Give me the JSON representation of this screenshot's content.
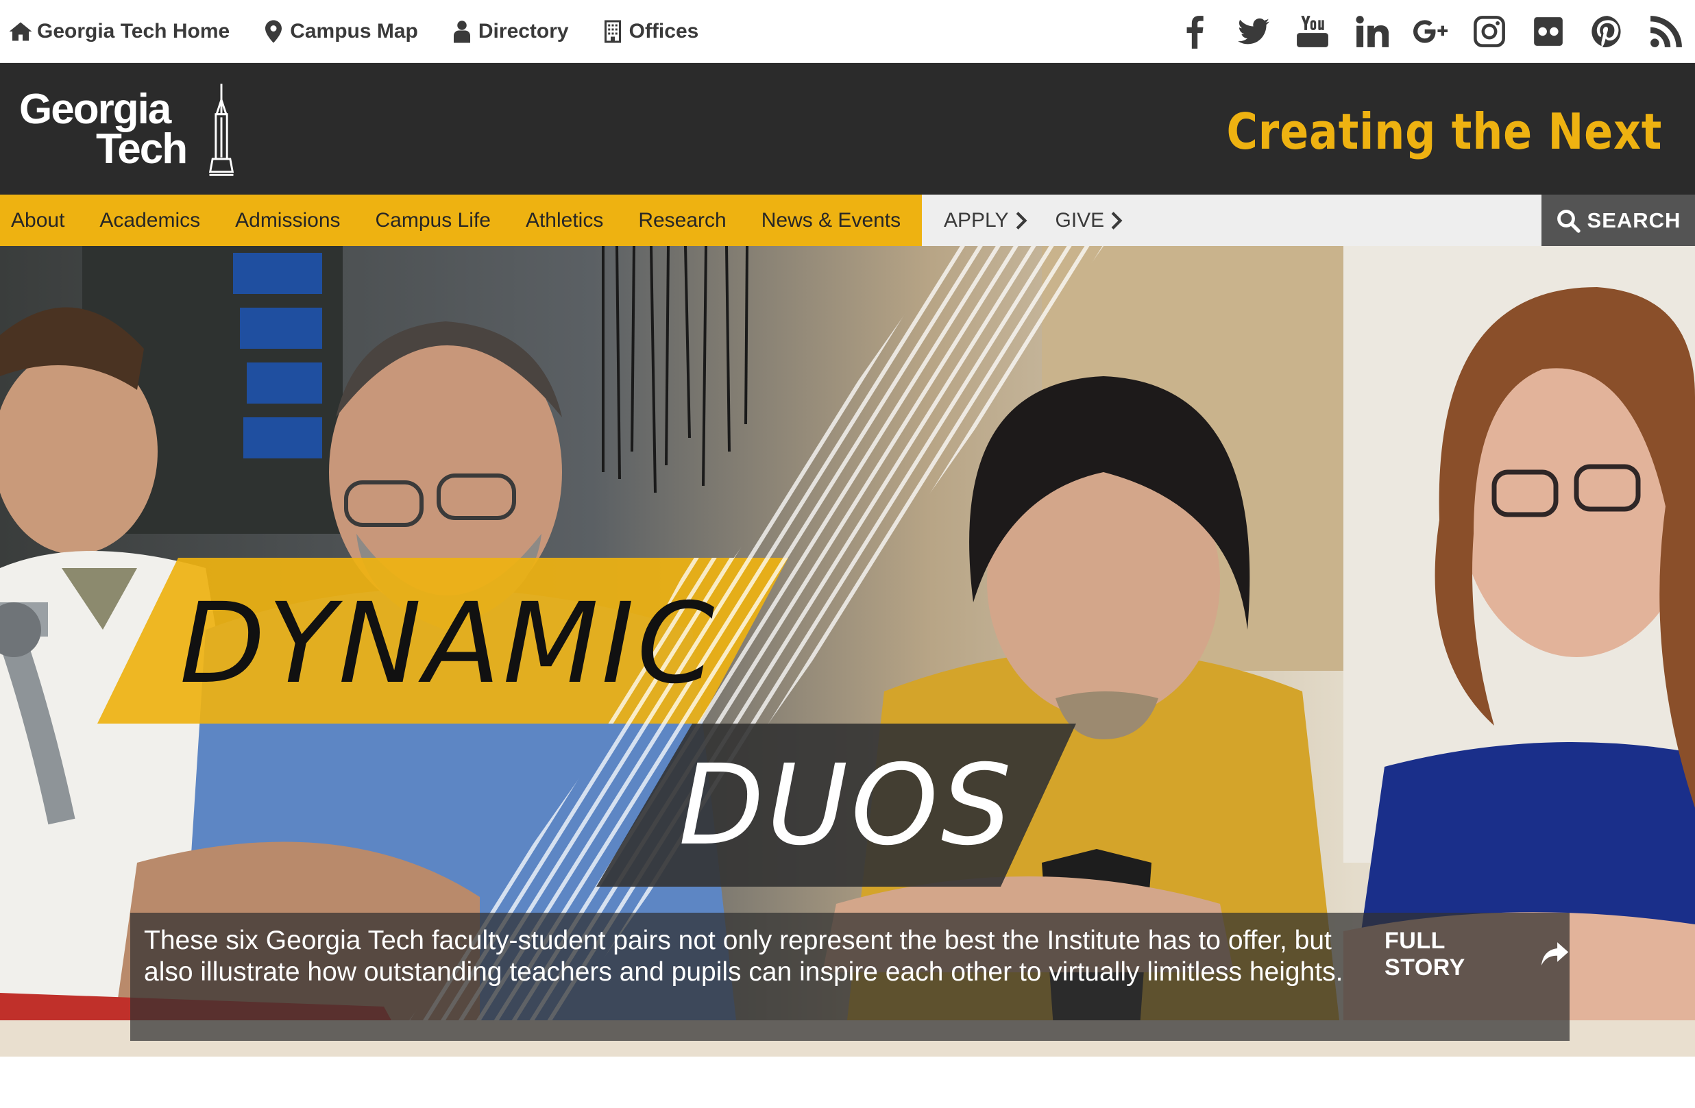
{
  "utility": {
    "links": [
      {
        "label": "Georgia Tech Home",
        "icon": "home-icon"
      },
      {
        "label": "Campus Map",
        "icon": "map-pin-icon"
      },
      {
        "label": "Directory",
        "icon": "person-icon"
      },
      {
        "label": "Offices",
        "icon": "building-icon"
      }
    ],
    "social": [
      "facebook-icon",
      "twitter-icon",
      "youtube-icon",
      "linkedin-icon",
      "google-plus-icon",
      "instagram-icon",
      "flickr-icon",
      "pinterest-icon",
      "rss-icon"
    ]
  },
  "brand": {
    "logo_line1": "Georgia",
    "logo_line2": "Tech",
    "tagline": "Creating the Next",
    "colors": {
      "gold": "#eeb211",
      "dark": "#2b2b2b",
      "nav_gray": "#eeeeee",
      "search_bg": "#545454"
    }
  },
  "nav": {
    "items": [
      "About",
      "Academics",
      "Admissions",
      "Campus Life",
      "Athletics",
      "Research",
      "News & Events"
    ],
    "apply": "APPLY",
    "give": "GIVE",
    "search": "SEARCH"
  },
  "hero": {
    "headline_line1": "DYNAMIC",
    "headline_line2": "DUOS",
    "caption": "These six Georgia Tech faculty-student pairs not only represent the best the Institute has to offer, but also illustrate how outstanding teachers and pupils can inspire each other to virtually limitless heights.",
    "cta": "FULL STORY"
  }
}
